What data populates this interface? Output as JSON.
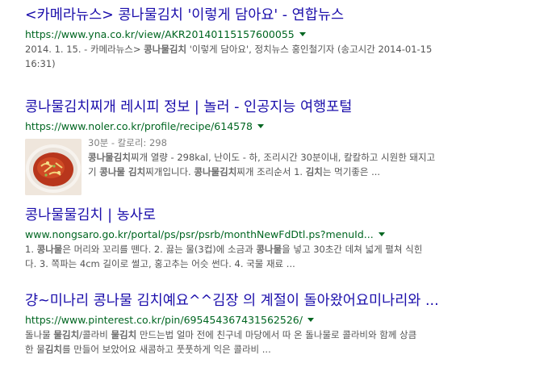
{
  "results": [
    {
      "title": "<카메라뉴스> 콩나물김치 '이렇게 담아요' - 연합뉴스",
      "url": "https://www.yna.co.kr/view/AKR20140115157600055",
      "snippet_lines": [
        [
          "2014. 1. 15. - 카메라뉴스> ",
          "콩나물김치",
          " '이렇게 담아요', 정치뉴스 홍인철기자 (송고시간 2014-01-15"
        ],
        [
          "16:31)"
        ]
      ]
    },
    {
      "title": "콩나물김치찌개 레시피 정보 | 놀러 - 인공지능 여행포털",
      "url": "https://www.noler.co.kr/profile/recipe/614578",
      "meta": "30분 - 칼로리: 298",
      "snippet_lines": [
        [
          "",
          "콩나물김치",
          "찌개 열량 - 298kal, 난이도 - 하, 조리시간 30분이내, 칼칼하고 시원한 돼지고"
        ],
        [
          "기 ",
          "콩나물 김치",
          "찌개입니다. ",
          "콩나물김치",
          "찌개 조리순서 1. ",
          "김치",
          "는 먹기좋은 ..."
        ]
      ]
    },
    {
      "title": "콩나물물김치 | 농사로",
      "url": "www.nongsaro.go.kr/portal/ps/psr/psrb/monthNewFdDtl.ps?menuId...",
      "snippet_lines": [
        [
          "1. ",
          "콩나물",
          "은 머리와 꼬리를 뗀다. 2. 끓는 물(3컵)에 소금과 ",
          "콩나물",
          "을 넣고 30초간 데쳐 넓게 펼쳐 식힌"
        ],
        [
          "다. 3. 쪽파는 4cm 길이로 썰고, 홍고추는 어슷 썬다. 4. 국물 재료 ..."
        ]
      ]
    },
    {
      "title": "걍~미나리 콩나물 김치예요^^김장 의 계절이 돌아왔어요미나리와 ...",
      "url": "https://www.pinterest.co.kr/pin/695454367431562526/",
      "snippet_lines": [
        [
          "돌나물 ",
          "물김치",
          "/콜라비 ",
          "물김치",
          " 만드는법 얼마 전에 친구네 마당에서 따 온 돌나물로 콜라비와 함께 상큼"
        ],
        [
          "한 물",
          "김치",
          "를 만들어 보았어요 새콤하고 풋풋하게 익은 콜라비 ..."
        ]
      ]
    }
  ]
}
